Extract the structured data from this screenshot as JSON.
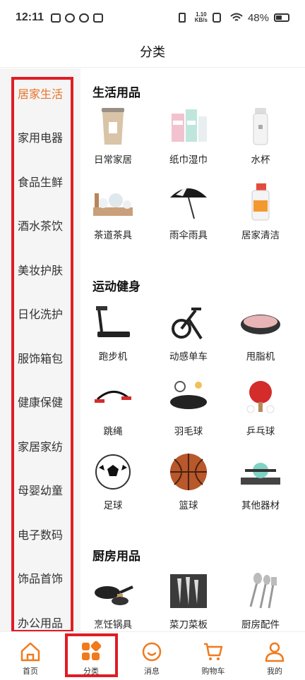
{
  "status_bar": {
    "time": "12:11",
    "speed_value": "1.10",
    "speed_unit": "KB/s",
    "battery": "48%"
  },
  "header": {
    "title": "分类"
  },
  "left_nav": {
    "items": [
      "居家生活",
      "家用电器",
      "食品生鲜",
      "酒水茶饮",
      "美妆护肤",
      "日化洗护",
      "服饰箱包",
      "健康保健",
      "家居家纺",
      "母婴幼童",
      "电子数码",
      "饰品首饰",
      "办公用品"
    ],
    "active_index": 0
  },
  "sections": [
    {
      "title": "生活用品",
      "items": [
        "日常家居",
        "纸巾湿巾",
        "水杯",
        "茶道茶具",
        "雨伞雨具",
        "居家清洁"
      ]
    },
    {
      "title": "运动健身",
      "items": [
        "跑步机",
        "动感单车",
        "甩脂机",
        "跳绳",
        "羽毛球",
        "乒乓球",
        "足球",
        "篮球",
        "其他器材"
      ]
    },
    {
      "title": "厨房用品",
      "items": [
        "烹饪锅具",
        "菜刀菜板",
        "厨房配件"
      ]
    }
  ],
  "tab_bar": {
    "items": [
      "首页",
      "分类",
      "消息",
      "购物车",
      "我的"
    ],
    "active_index": 1
  },
  "colors": {
    "accent": "#f07a1e",
    "highlight_box": "#e01c24",
    "active_text": "#e8742a",
    "nav_bg": "#f5f5f5"
  }
}
